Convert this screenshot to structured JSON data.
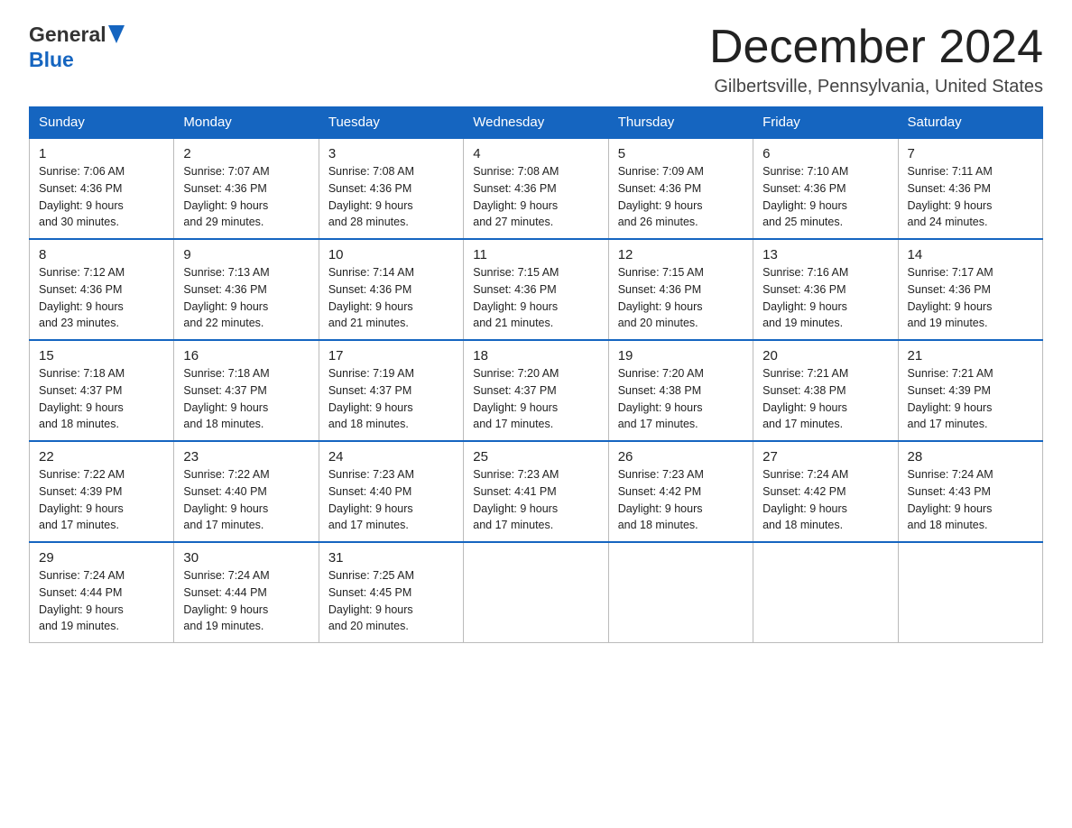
{
  "logo": {
    "general": "General",
    "blue": "Blue"
  },
  "title": "December 2024",
  "location": "Gilbertsville, Pennsylvania, United States",
  "days_of_week": [
    "Sunday",
    "Monday",
    "Tuesday",
    "Wednesday",
    "Thursday",
    "Friday",
    "Saturday"
  ],
  "weeks": [
    [
      {
        "day": "1",
        "sunrise": "7:06 AM",
        "sunset": "4:36 PM",
        "daylight": "9 hours and 30 minutes."
      },
      {
        "day": "2",
        "sunrise": "7:07 AM",
        "sunset": "4:36 PM",
        "daylight": "9 hours and 29 minutes."
      },
      {
        "day": "3",
        "sunrise": "7:08 AM",
        "sunset": "4:36 PM",
        "daylight": "9 hours and 28 minutes."
      },
      {
        "day": "4",
        "sunrise": "7:08 AM",
        "sunset": "4:36 PM",
        "daylight": "9 hours and 27 minutes."
      },
      {
        "day": "5",
        "sunrise": "7:09 AM",
        "sunset": "4:36 PM",
        "daylight": "9 hours and 26 minutes."
      },
      {
        "day": "6",
        "sunrise": "7:10 AM",
        "sunset": "4:36 PM",
        "daylight": "9 hours and 25 minutes."
      },
      {
        "day": "7",
        "sunrise": "7:11 AM",
        "sunset": "4:36 PM",
        "daylight": "9 hours and 24 minutes."
      }
    ],
    [
      {
        "day": "8",
        "sunrise": "7:12 AM",
        "sunset": "4:36 PM",
        "daylight": "9 hours and 23 minutes."
      },
      {
        "day": "9",
        "sunrise": "7:13 AM",
        "sunset": "4:36 PM",
        "daylight": "9 hours and 22 minutes."
      },
      {
        "day": "10",
        "sunrise": "7:14 AM",
        "sunset": "4:36 PM",
        "daylight": "9 hours and 21 minutes."
      },
      {
        "day": "11",
        "sunrise": "7:15 AM",
        "sunset": "4:36 PM",
        "daylight": "9 hours and 21 minutes."
      },
      {
        "day": "12",
        "sunrise": "7:15 AM",
        "sunset": "4:36 PM",
        "daylight": "9 hours and 20 minutes."
      },
      {
        "day": "13",
        "sunrise": "7:16 AM",
        "sunset": "4:36 PM",
        "daylight": "9 hours and 19 minutes."
      },
      {
        "day": "14",
        "sunrise": "7:17 AM",
        "sunset": "4:36 PM",
        "daylight": "9 hours and 19 minutes."
      }
    ],
    [
      {
        "day": "15",
        "sunrise": "7:18 AM",
        "sunset": "4:37 PM",
        "daylight": "9 hours and 18 minutes."
      },
      {
        "day": "16",
        "sunrise": "7:18 AM",
        "sunset": "4:37 PM",
        "daylight": "9 hours and 18 minutes."
      },
      {
        "day": "17",
        "sunrise": "7:19 AM",
        "sunset": "4:37 PM",
        "daylight": "9 hours and 18 minutes."
      },
      {
        "day": "18",
        "sunrise": "7:20 AM",
        "sunset": "4:37 PM",
        "daylight": "9 hours and 17 minutes."
      },
      {
        "day": "19",
        "sunrise": "7:20 AM",
        "sunset": "4:38 PM",
        "daylight": "9 hours and 17 minutes."
      },
      {
        "day": "20",
        "sunrise": "7:21 AM",
        "sunset": "4:38 PM",
        "daylight": "9 hours and 17 minutes."
      },
      {
        "day": "21",
        "sunrise": "7:21 AM",
        "sunset": "4:39 PM",
        "daylight": "9 hours and 17 minutes."
      }
    ],
    [
      {
        "day": "22",
        "sunrise": "7:22 AM",
        "sunset": "4:39 PM",
        "daylight": "9 hours and 17 minutes."
      },
      {
        "day": "23",
        "sunrise": "7:22 AM",
        "sunset": "4:40 PM",
        "daylight": "9 hours and 17 minutes."
      },
      {
        "day": "24",
        "sunrise": "7:23 AM",
        "sunset": "4:40 PM",
        "daylight": "9 hours and 17 minutes."
      },
      {
        "day": "25",
        "sunrise": "7:23 AM",
        "sunset": "4:41 PM",
        "daylight": "9 hours and 17 minutes."
      },
      {
        "day": "26",
        "sunrise": "7:23 AM",
        "sunset": "4:42 PM",
        "daylight": "9 hours and 18 minutes."
      },
      {
        "day": "27",
        "sunrise": "7:24 AM",
        "sunset": "4:42 PM",
        "daylight": "9 hours and 18 minutes."
      },
      {
        "day": "28",
        "sunrise": "7:24 AM",
        "sunset": "4:43 PM",
        "daylight": "9 hours and 18 minutes."
      }
    ],
    [
      {
        "day": "29",
        "sunrise": "7:24 AM",
        "sunset": "4:44 PM",
        "daylight": "9 hours and 19 minutes."
      },
      {
        "day": "30",
        "sunrise": "7:24 AM",
        "sunset": "4:44 PM",
        "daylight": "9 hours and 19 minutes."
      },
      {
        "day": "31",
        "sunrise": "7:25 AM",
        "sunset": "4:45 PM",
        "daylight": "9 hours and 20 minutes."
      },
      null,
      null,
      null,
      null
    ]
  ],
  "labels": {
    "sunrise": "Sunrise:",
    "sunset": "Sunset:",
    "daylight": "Daylight:"
  }
}
